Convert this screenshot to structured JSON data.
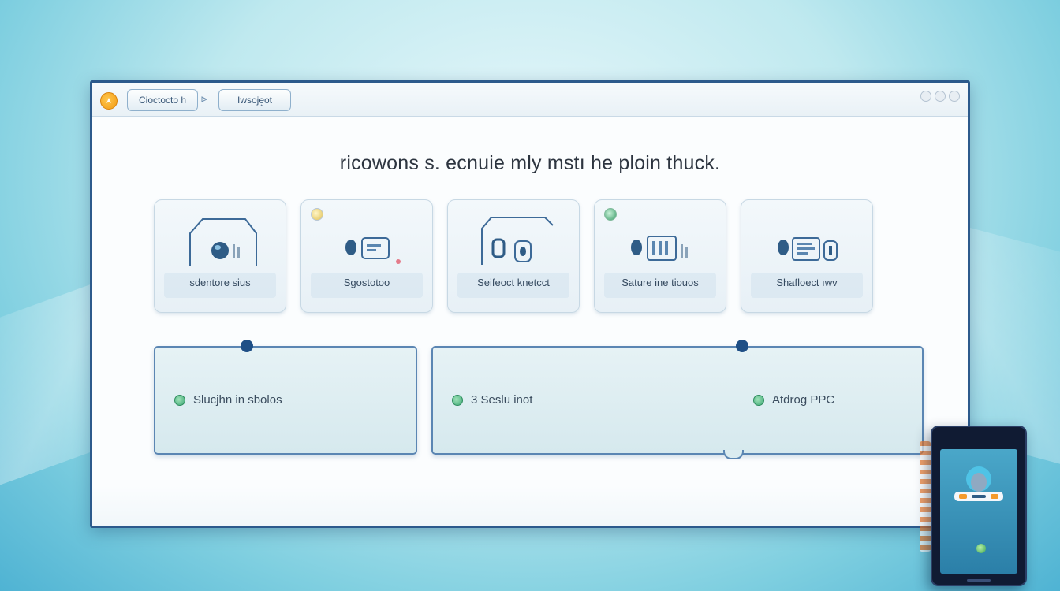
{
  "window": {
    "tabs": [
      {
        "label": "Cioctocto h"
      },
      {
        "label": "Iwsoje͙ot"
      }
    ]
  },
  "headline": "ricowons s. ecnuie mly mstı he ploin thuck.",
  "cards": [
    {
      "label": "sdentore sius",
      "icon": "cloud-monitor-icon"
    },
    {
      "label": "Sgostotoo",
      "icon": "chat-device-icon"
    },
    {
      "label": "Seifeoct knetcct",
      "icon": "phone-lock-icon"
    },
    {
      "label": "Sature ine tiouos",
      "icon": "device-stack-icon"
    },
    {
      "label": "Shafloect ıwv",
      "icon": "transfer-icon"
    }
  ],
  "panels": [
    {
      "items": [
        {
          "label": "Slucjhn in sbolos",
          "icon": "status-dot-icon"
        }
      ]
    },
    {
      "items": [
        {
          "label": "3 Seslu inot",
          "icon": "status-dot-icon"
        },
        {
          "label": "Atdrog PPC",
          "icon": "status-dot-icon"
        }
      ]
    }
  ],
  "colors": {
    "accent": "#2c5a8c",
    "panel_border": "#5b86b3",
    "status_green": "#3da874",
    "logo_orange": "#f29a12"
  }
}
